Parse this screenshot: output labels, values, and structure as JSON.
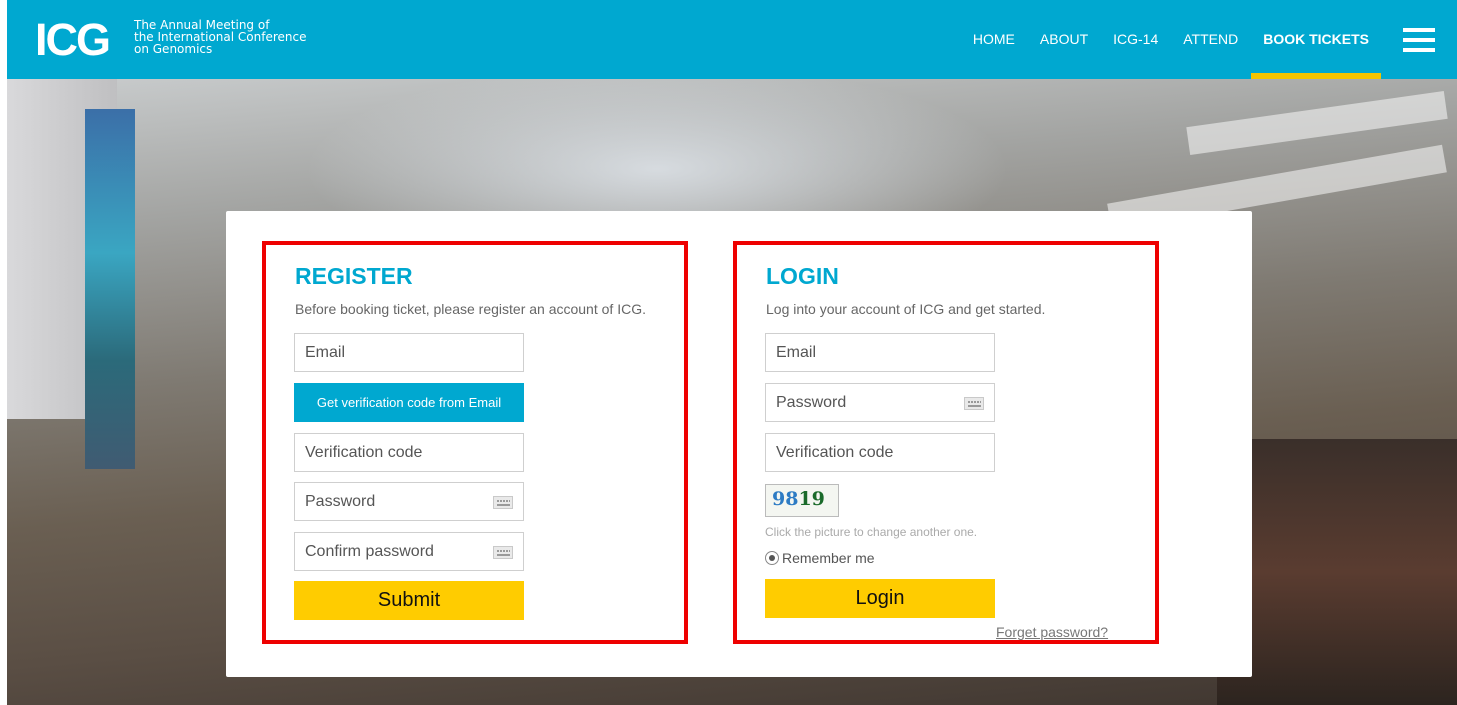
{
  "header": {
    "logo": "ICG",
    "logo_sub": [
      "The Annual Meeting of",
      "the International Conference",
      "on Genomics"
    ],
    "nav": [
      "HOME",
      "ABOUT",
      "ICG-14",
      "ATTEND",
      "BOOK TICKETS"
    ],
    "active_nav": "BOOK TICKETS",
    "menu_icon": "hamburger-menu-icon"
  },
  "register": {
    "title": "REGISTER",
    "description": "Before booking ticket, please register an account of ICG.",
    "email_placeholder": "Email",
    "verify_button": "Get verification code from Email",
    "code_placeholder": "Verification code",
    "password_placeholder": "Password",
    "confirm_placeholder": "Confirm password",
    "submit": "Submit"
  },
  "login": {
    "title": "LOGIN",
    "description": "Log into your account of ICG and get started.",
    "email_placeholder": "Email",
    "password_placeholder": "Password",
    "code_placeholder": "Verification code",
    "captcha_text": "9819",
    "captcha_hint": "Click the picture to change another one.",
    "remember": "Remember me",
    "login_button": "Login",
    "forgot": "Forget password?"
  },
  "colors": {
    "brand": "#00a8d0",
    "accent": "#ffcc00",
    "highlight_box": "#ee0000"
  }
}
